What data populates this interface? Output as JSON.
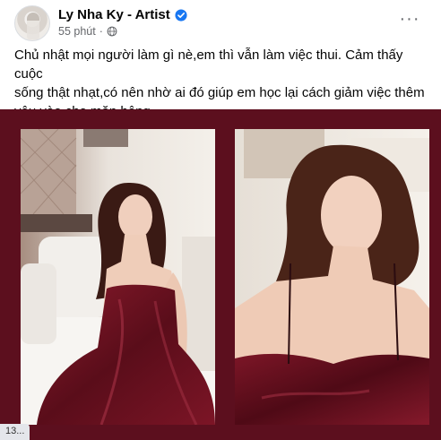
{
  "post": {
    "page_name": "Ly Nha Ky - Artist",
    "time": "55 phút",
    "more_glyph": "···",
    "caption": "Chủ nhật mọi người làm gì nè,em thì vẫn làm việc thui. Cảm thấy cuộc\nsống thật nhạt,có nên nhờ ai đó giúp em học lại cách giảm việc thêm\nyêu vào cho mặn hông",
    "icons": {
      "verified": "verified-badge-icon",
      "audience": "public-globe-icon",
      "more": "more-options-icon"
    }
  },
  "photos": {
    "background": "#5c0f1e",
    "dress_color": "#6b1020",
    "items": [
      {
        "subject": "woman in burgundy satin dress sitting on bed"
      },
      {
        "subject": "close-up of woman in burgundy satin dress"
      }
    ]
  },
  "status_bar": {
    "text": "13..."
  }
}
